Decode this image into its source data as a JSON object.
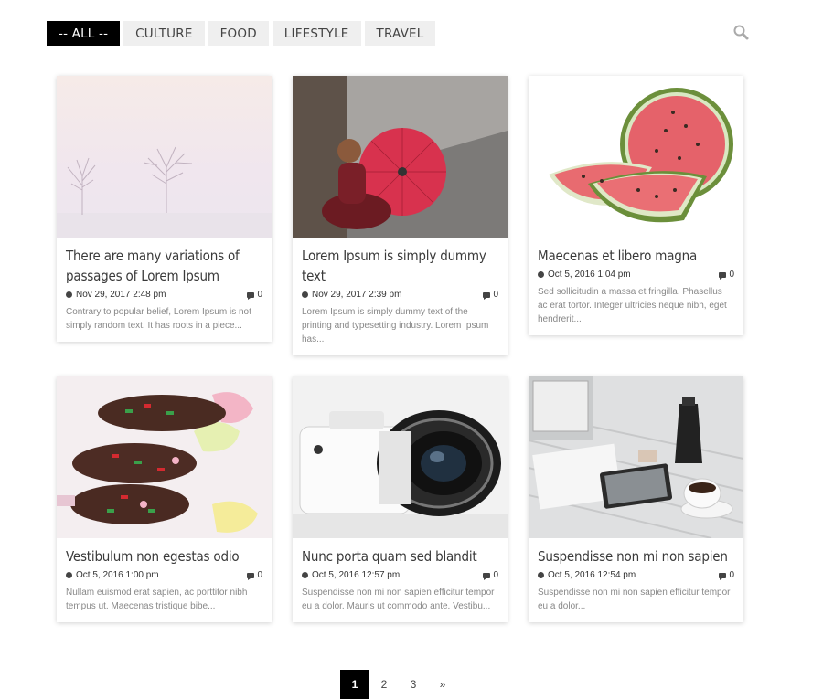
{
  "filters": [
    {
      "label": "-- ALL --",
      "active": true
    },
    {
      "label": "CULTURE",
      "active": false
    },
    {
      "label": "FOOD",
      "active": false
    },
    {
      "label": "LIFESTYLE",
      "active": false
    },
    {
      "label": "TRAVEL",
      "active": false
    }
  ],
  "search": {
    "icon": "search-icon"
  },
  "posts": [
    {
      "title": "There are many variations of passages of Lorem Ipsum",
      "date": "Nov 29, 2017 2:48 pm",
      "comments": "0",
      "excerpt": "Contrary to popular belief, Lorem Ipsum is not simply random text. It has roots in a piece..."
    },
    {
      "title": "Lorem Ipsum is simply dummy text",
      "date": "Nov 29, 2017 2:39 pm",
      "comments": "0",
      "excerpt": "Lorem Ipsum is simply dummy text of the printing and typesetting industry. Lorem Ipsum has..."
    },
    {
      "title": "Maecenas et libero magna",
      "date": "Oct 5, 2016 1:04 pm",
      "comments": "0",
      "excerpt": "Sed sollicitudin a massa et fringilla. Phasellus ac erat tortor. Integer ultricies neque nibh, eget hendrerit..."
    },
    {
      "title": "Vestibulum non egestas odio",
      "date": "Oct 5, 2016 1:00 pm",
      "comments": "0",
      "excerpt": "Nullam euismod erat sapien, ac porttitor nibh tempus ut. Maecenas tristique bibe..."
    },
    {
      "title": "Nunc porta quam sed blandit",
      "date": "Oct 5, 2016 12:57 pm",
      "comments": "0",
      "excerpt": "Suspendisse non mi non sapien efficitur tempor eu a dolor. Mauris ut commodo ante. Vestibu..."
    },
    {
      "title": "Suspendisse non mi non sapien",
      "date": "Oct 5, 2016 12:54 pm",
      "comments": "0",
      "excerpt": "Suspendisse non mi non sapien efficitur tempor eu a dolor..."
    }
  ],
  "pagination": {
    "pages": [
      "1",
      "2",
      "3"
    ],
    "current": "1",
    "next": "»"
  }
}
